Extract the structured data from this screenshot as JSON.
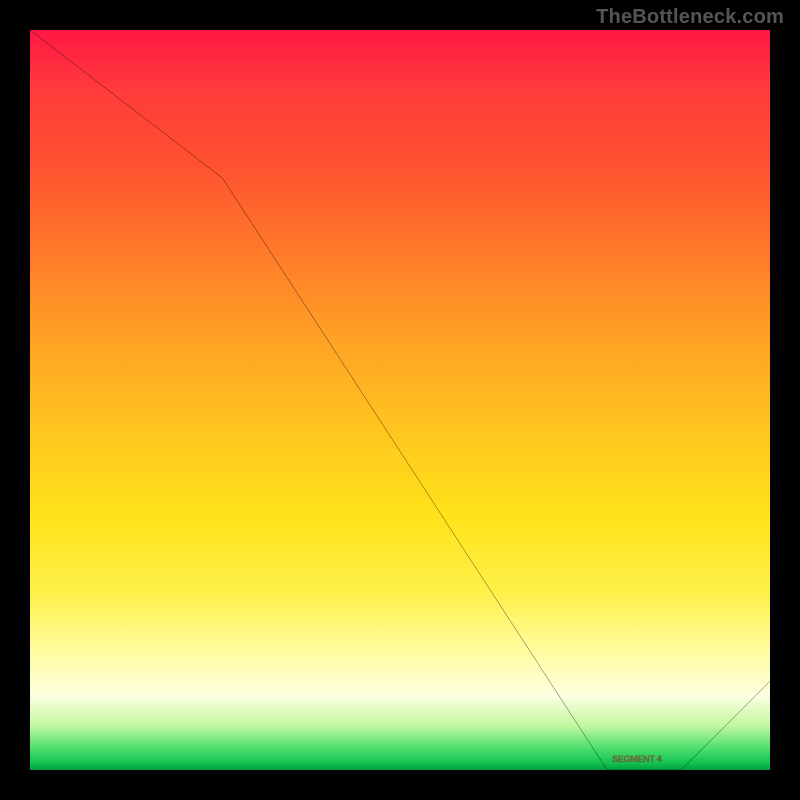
{
  "attribution": "TheBottleneck.com",
  "colors": {
    "top": "#ff1744",
    "bottom": "#00a040",
    "curve": "#000000"
  },
  "segment_label": "SEGMENT 4",
  "chart_data": {
    "type": "line",
    "title": "",
    "xlabel": "",
    "ylabel": "",
    "xlim": [
      0,
      100
    ],
    "ylim": [
      0,
      100
    ],
    "grid": false,
    "axes_visible": false,
    "legend": false,
    "annotations": [
      {
        "text": "SEGMENT 4",
        "x": 82,
        "y": 0
      }
    ],
    "series": [
      {
        "name": "curve",
        "x": [
          0,
          26,
          78,
          88,
          100
        ],
        "values": [
          100,
          80,
          0,
          0,
          12
        ]
      }
    ],
    "notes": "No numeric axis ticks are visible; x and y are normalized 0–100 based on plot extents. Values estimated from curve geometry."
  }
}
